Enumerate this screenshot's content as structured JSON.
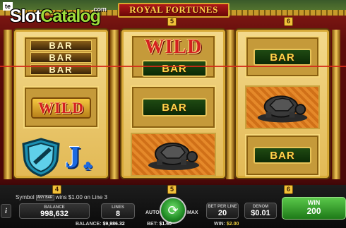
{
  "logo": {
    "tab": "te",
    "slot": "Slot",
    "catalog": "Catalog",
    "com": ".com"
  },
  "title": "ROYAL FORTUNES",
  "line_badges": {
    "top_left": "5",
    "top_right": "6",
    "bottom_left": "4",
    "bottom_mid": "5",
    "bottom_right": "6"
  },
  "reels": {
    "reel1": {
      "bar1": "BAR",
      "bar2": "BAR",
      "bar3": "BAR",
      "wild": "WILD",
      "jack": "J"
    },
    "reel2": {
      "wild": "WILD",
      "bar_top": "BAR",
      "bar_mid": "BAR"
    },
    "reel3": {
      "bar_top": "BAR",
      "bar_bottom": "BAR"
    }
  },
  "symbols": {
    "shield": "shield-icon",
    "jack": "jack-clubs-icon",
    "turtle": "turtle-icon"
  },
  "panel": {
    "info": "i",
    "win_message_symbol": "Symbol",
    "win_message_any": "ANY BAR",
    "win_message_rest": "wins $1.00 on Line 3",
    "balance_label": "BALANCE",
    "balance_value": "998,632",
    "lines_label": "LINES",
    "lines_value": "8",
    "auto": "AUTO",
    "max": "MAX",
    "bet_per_line_label": "BET PER LINE",
    "bet_per_line_value": "20",
    "denom_label": "DENOM",
    "denom_value": "$0.01",
    "win_label": "WIN",
    "win_value": "200"
  },
  "footer": {
    "balance_label": "BALANCE:",
    "balance_value": "$9,986.32",
    "bet_label": "BET:",
    "bet_value": "$1.60",
    "win_label": "WIN:",
    "win_value": "$2.00"
  },
  "colors": {
    "accent_gold": "#d7aa38",
    "win_green": "#3aa030",
    "win_line": "#d42a18"
  }
}
